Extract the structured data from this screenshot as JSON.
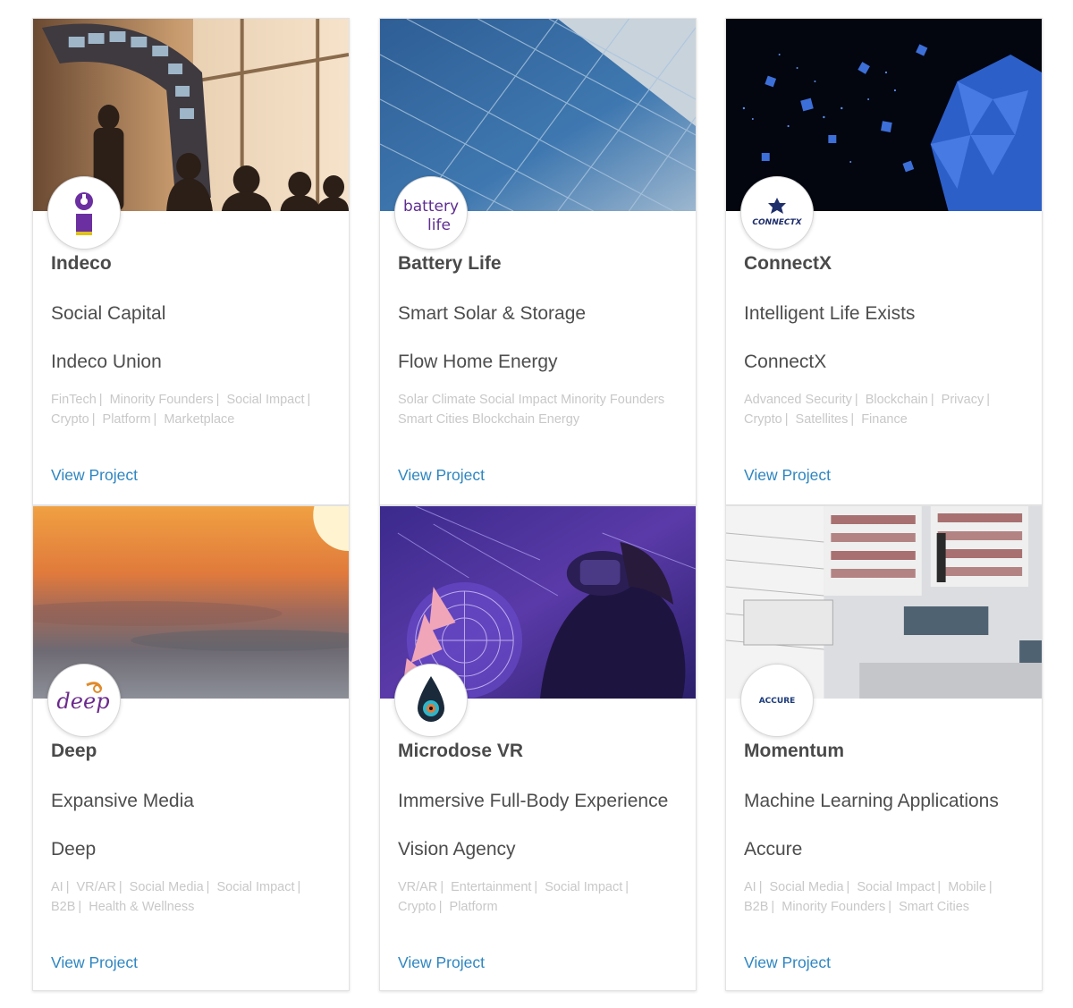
{
  "cards": [
    {
      "name": "Indeco",
      "tagline": "Social Capital",
      "company": "Indeco Union",
      "tags": [
        "FinTech",
        "Minority Founders",
        "Social Impact",
        "Crypto",
        "Platform",
        "Marketplace"
      ],
      "cta": "View Project",
      "logo_text": "",
      "banner_icon": "people-in-gallery-photo"
    },
    {
      "name": "Battery Life",
      "tagline": "Smart Solar & Storage",
      "company": "Flow Home Energy",
      "tags_text": "Solar Climate Social Impact Minority Founders Smart Cities Blockchain Energy",
      "cta": "View Project",
      "logo_text": [
        "battery",
        "life"
      ],
      "banner_icon": "solar-panel-photo"
    },
    {
      "name": "ConnectX",
      "tagline": "Intelligent Life Exists",
      "company": "ConnectX",
      "tags": [
        "Advanced Security",
        "Blockchain",
        "Privacy",
        "Crypto",
        "Satellites",
        "Finance"
      ],
      "cta": "View Project",
      "logo_text": "CONNECTX",
      "banner_icon": "planet-cubes-photo"
    },
    {
      "name": "Deep",
      "tagline": "Expansive Media",
      "company": "Deep",
      "tags": [
        "AI",
        "VR/AR",
        "Social Media",
        "Social Impact",
        "B2B",
        "Health & Wellness"
      ],
      "cta": "View Project",
      "logo_text": "deep",
      "banner_icon": "ocean-sunset-photo"
    },
    {
      "name": "Microdose VR",
      "tagline": "Immersive Full-Body Experience",
      "company": "Vision Agency",
      "tags": [
        "VR/AR",
        "Entertainment",
        "Social Impact",
        "Crypto",
        "Platform"
      ],
      "cta": "View Project",
      "logo_text": "",
      "banner_icon": "vr-headset-photo"
    },
    {
      "name": "Momentum",
      "tagline": "Machine Learning Applications",
      "company": "Accure",
      "tags": [
        "AI",
        "Social Media",
        "Social Impact",
        "Mobile",
        "B2B",
        "Minority Founders",
        "Smart Cities"
      ],
      "cta": "View Project",
      "logo_text": "ACCURE",
      "banner_icon": "library-interior-photo"
    }
  ],
  "colors": {
    "link": "#2e86c1",
    "tag": "#c8c8c8",
    "title": "#4a4a4a"
  }
}
